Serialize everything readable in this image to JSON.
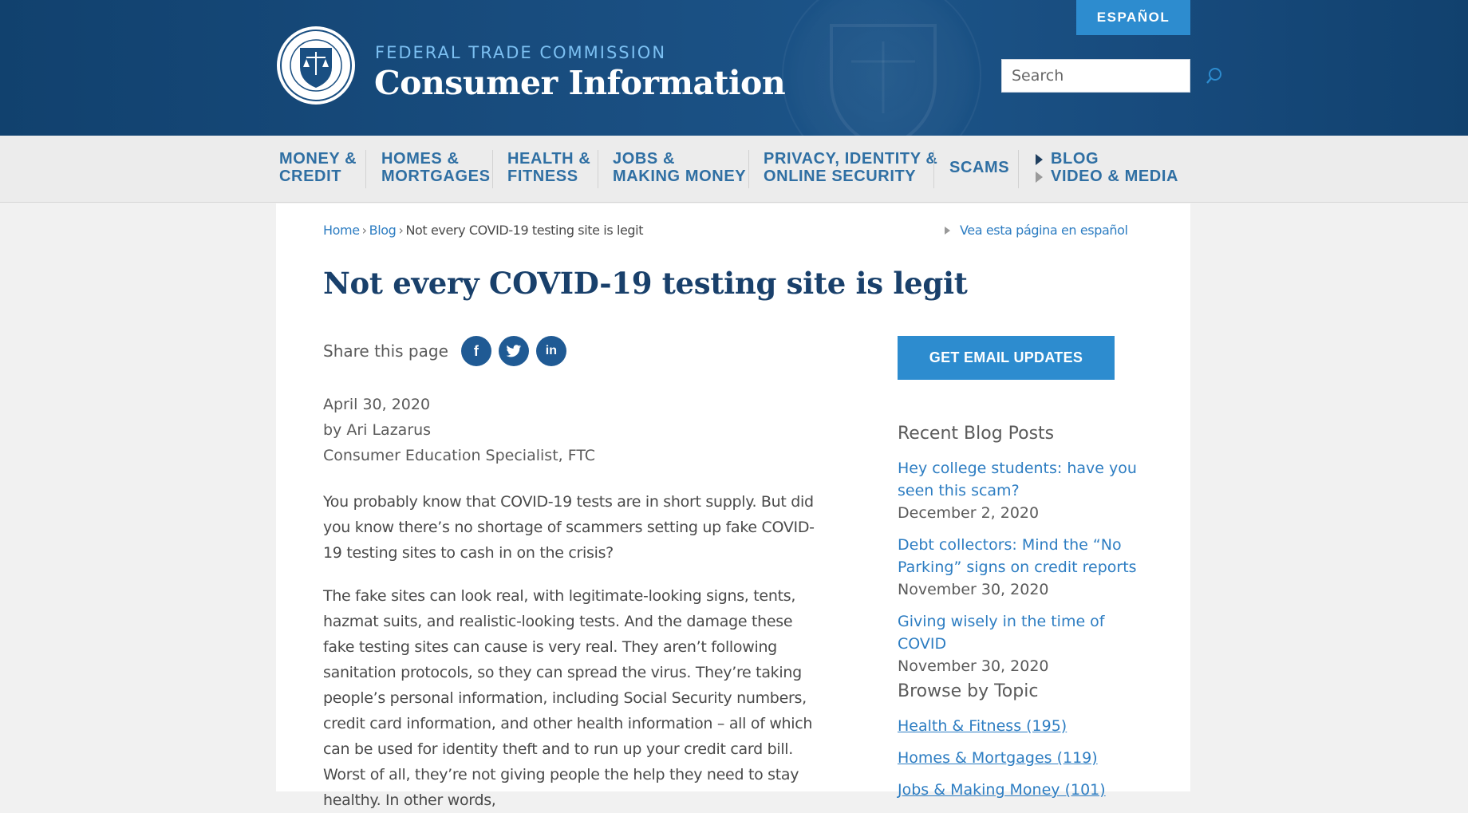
{
  "header": {
    "agency": "FEDERAL TRADE COMMISSION",
    "site_title": "Consumer Information",
    "espanol_label": "ESPAÑOL",
    "search_placeholder": "Search"
  },
  "nav": {
    "items": [
      {
        "line1": "MONEY &",
        "line2": "CREDIT"
      },
      {
        "line1": "HOMES &",
        "line2": "MORTGAGES"
      },
      {
        "line1": "HEALTH &",
        "line2": "FITNESS"
      },
      {
        "line1": "JOBS &",
        "line2": "MAKING MONEY"
      },
      {
        "line1": "PRIVACY, IDENTITY &",
        "line2": "ONLINE SECURITY"
      },
      {
        "line1": "SCAMS",
        "line2": ""
      }
    ],
    "blog": "BLOG",
    "video": "VIDEO & MEDIA"
  },
  "breadcrumb": {
    "home": "Home",
    "blog": "Blog",
    "current": "Not every COVID-19 testing site is legit",
    "sep": "›"
  },
  "spanish_link": "Vea esta página en español",
  "article": {
    "title": "Not every COVID-19 testing site is legit",
    "share_label": "Share this page",
    "date": "April 30, 2020",
    "author": "by Ari Lazarus",
    "role": "Consumer Education Specialist, FTC",
    "p1": "You probably know that COVID-19 tests are in short supply. But did you know there’s no shortage of scammers setting up fake COVID-19 testing sites to cash in on the crisis?",
    "p2": "The fake sites can look real, with legitimate-looking signs, tents, hazmat suits, and realistic-looking tests. And the damage these fake testing sites can cause is very real. They aren’t following sanitation protocols, so they can spread the virus. They’re taking people’s personal information, including Social Security numbers, credit card information, and other health information – all of which can be used for identity theft and to run up your credit card bill. Worst of all, they’re not giving people the help they need to stay healthy. In other words,"
  },
  "sidebar": {
    "email_button": "GET EMAIL UPDATES",
    "recent_heading": "Recent Blog Posts",
    "posts": [
      {
        "title": "Hey college students: have you seen this scam?",
        "date": "December 2, 2020"
      },
      {
        "title": "Debt collectors: Mind the “No Parking” signs on credit reports",
        "date": "November 30, 2020"
      },
      {
        "title": "Giving wisely in the time of COVID",
        "date": "November 30, 2020"
      }
    ],
    "topics_heading": "Browse by Topic",
    "topics": [
      "Health & Fitness (195)",
      "Homes & Mortgages (119)",
      "Jobs & Making Money (101)"
    ]
  },
  "icons": {
    "facebook": "f",
    "linkedin": "in"
  },
  "colors": {
    "header_bg": "#174a7c",
    "accent": "#2d8ccf",
    "link": "#2d7dc2",
    "title": "#19406b"
  }
}
